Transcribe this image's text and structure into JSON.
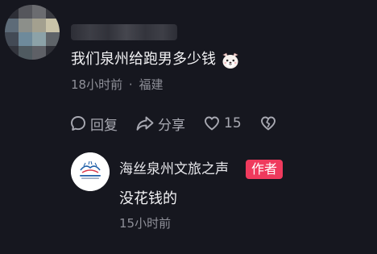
{
  "comment": {
    "text": "我们泉州给跑男多少钱",
    "emoji": "dog-face-emoji",
    "time": "18小时前",
    "separator": "·",
    "location": "福建"
  },
  "actions": {
    "reply_label": "回复",
    "share_label": "分享",
    "like_count": "15"
  },
  "reply": {
    "author": "海丝泉州文旅之声",
    "badge": "作者",
    "text": "没花钱的",
    "time": "15小时前"
  },
  "colors": {
    "background": "#16171f",
    "badge": "#ef3a5d",
    "meta": "#8f9099"
  },
  "icons": [
    "chat-bubble-icon",
    "share-arrow-icon",
    "heart-icon",
    "broken-heart-icon"
  ]
}
